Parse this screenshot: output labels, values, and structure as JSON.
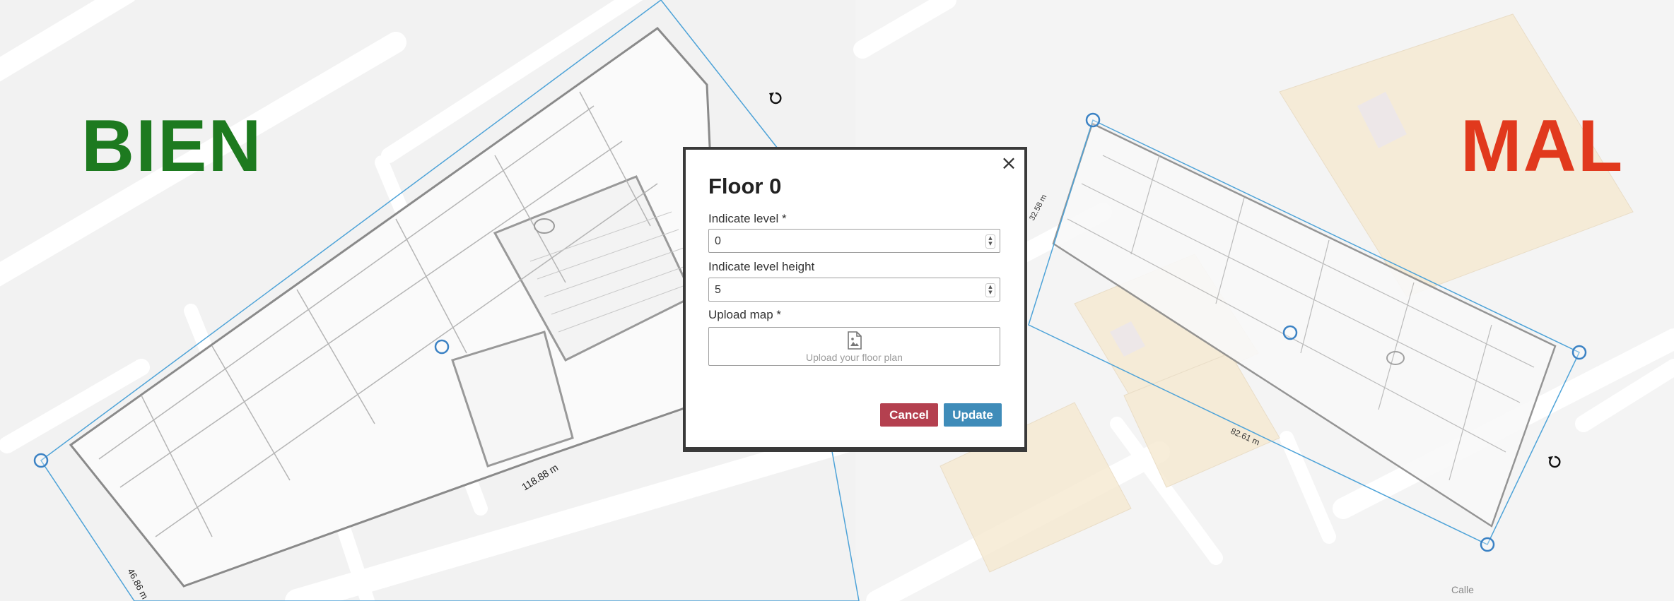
{
  "labels": {
    "good": "BIEN",
    "bad": "MAL",
    "good_color": "#1d7a1f",
    "bad_color": "#e1391d"
  },
  "map": {
    "left_width_label": "118.88 m",
    "left_height_label": "46.86 m",
    "right_width_label": "82.61 m",
    "right_height_label": "32.58 m",
    "street_label": "Calle"
  },
  "dialog": {
    "title": "Floor 0",
    "close_icon": "close-icon",
    "level_label": "Indicate level *",
    "level_value": "0",
    "height_label": "Indicate level height",
    "height_value": "5",
    "upload_label": "Upload map *",
    "upload_icon": "image-file-icon",
    "upload_hint": "Upload your floor plan",
    "cancel_label": "Cancel",
    "update_label": "Update",
    "cancel_color": "#b4404f",
    "update_color": "#3f8cb9"
  }
}
